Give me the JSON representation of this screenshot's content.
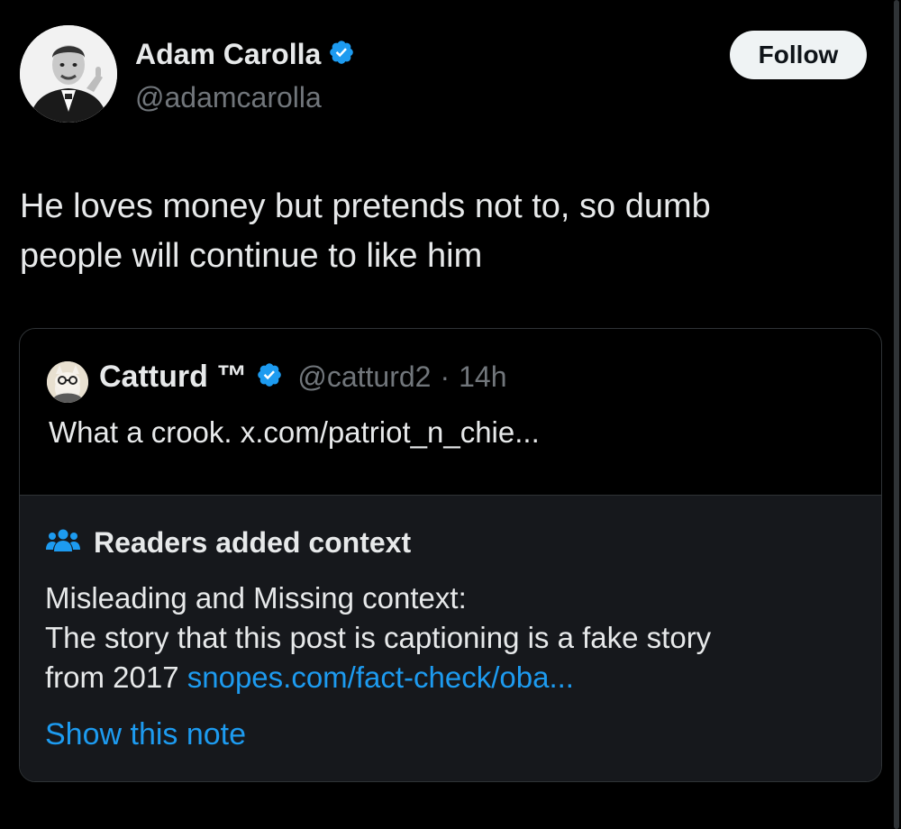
{
  "author": {
    "name": "Adam Carolla",
    "handle": "@adamcarolla",
    "follow_label": "Follow"
  },
  "tweet": {
    "lines": [
      "He loves money but pretends not to, so dumb",
      "people will continue to like him"
    ]
  },
  "quoted": {
    "name": "Catturd ™",
    "handle": "@catturd2",
    "separator": "·",
    "time": "14h",
    "text": "What a crook. x.com/patriot_n_chie..."
  },
  "community_note": {
    "title": "Readers added context",
    "line1": "Misleading and Missing context:",
    "line2": "The story that this post is captioning is a fake story",
    "line3_prefix": "from 2017 ",
    "line3_link": "snopes.com/fact-check/oba...",
    "show_label": "Show this note"
  },
  "colors": {
    "background": "#000000",
    "text": "#e7e9ea",
    "muted": "#71767b",
    "accent": "#1d9bf0",
    "note_bg": "#16181c",
    "border": "#2f3336"
  },
  "icons": {
    "verified": "verified-badge-icon",
    "readers": "people-group-icon"
  }
}
